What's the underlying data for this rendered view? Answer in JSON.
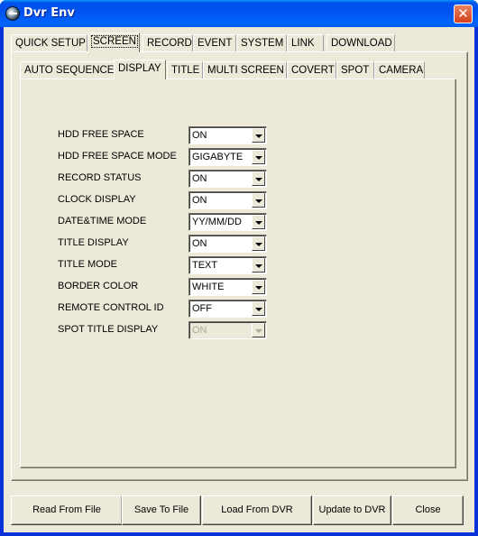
{
  "window": {
    "title": "Dvr Env",
    "app_icon": "dvr-globe-icon",
    "close_icon": "close-x-icon",
    "close_glyph": "✕"
  },
  "main_tabs": [
    {
      "label": "QUICK SETUP",
      "active": false
    },
    {
      "label": "SCREEN",
      "active": true
    },
    {
      "label": "RECORD",
      "active": false
    },
    {
      "label": "EVENT",
      "active": false
    },
    {
      "label": "SYSTEM",
      "active": false
    },
    {
      "label": "LINK",
      "active": false
    },
    {
      "label": "DOWNLOAD",
      "active": false
    }
  ],
  "sub_tabs": [
    {
      "label": "AUTO SEQUENCE",
      "active": false
    },
    {
      "label": "DISPLAY",
      "active": true
    },
    {
      "label": "TITLE",
      "active": false
    },
    {
      "label": "MULTI SCREEN",
      "active": false
    },
    {
      "label": "COVERT",
      "active": false
    },
    {
      "label": "SPOT",
      "active": false
    },
    {
      "label": "CAMERA",
      "active": false
    }
  ],
  "settings": [
    {
      "label": "HDD FREE SPACE",
      "value": "ON",
      "enabled": true
    },
    {
      "label": "HDD FREE SPACE MODE",
      "value": "GIGABYTE",
      "enabled": true
    },
    {
      "label": "RECORD STATUS",
      "value": "ON",
      "enabled": true
    },
    {
      "label": "CLOCK DISPLAY",
      "value": "ON",
      "enabled": true
    },
    {
      "label": "DATE&TIME MODE",
      "value": "YY/MM/DD",
      "enabled": true
    },
    {
      "label": "TITLE DISPLAY",
      "value": "ON",
      "enabled": true
    },
    {
      "label": "TITLE MODE",
      "value": "TEXT",
      "enabled": true
    },
    {
      "label": "BORDER COLOR",
      "value": "WHITE",
      "enabled": true
    },
    {
      "label": "REMOTE CONTROL ID",
      "value": "OFF",
      "enabled": true
    },
    {
      "label": "SPOT TITLE DISPLAY",
      "value": "ON",
      "enabled": false
    }
  ],
  "buttons": {
    "read_from_file": "Read From File",
    "save_to_file": "Save To File",
    "load_from_dvr": "Load From DVR",
    "update_to_dvr": "Update to DVR",
    "close": "Close"
  },
  "colors": {
    "titlebar": "#0054e3",
    "face": "#ece9d8",
    "close_button": "#d6401c",
    "disabled_text": "#aca899"
  }
}
